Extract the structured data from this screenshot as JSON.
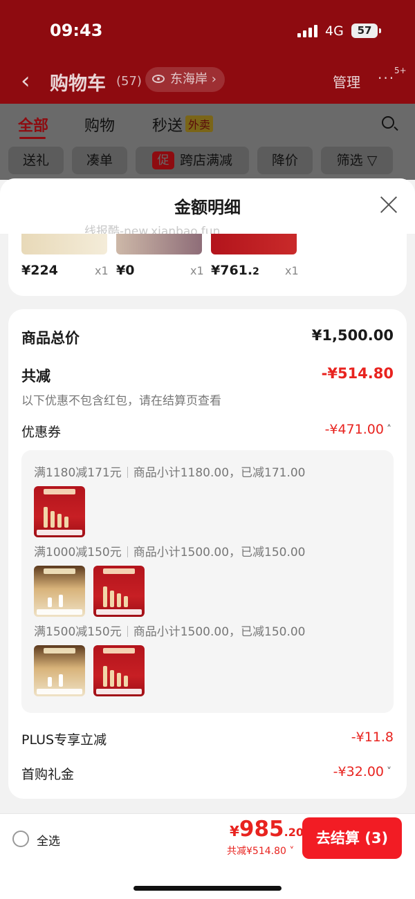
{
  "status": {
    "time": "09:43",
    "network": "4G",
    "battery": "57"
  },
  "header": {
    "title": "购物车",
    "count": "(57)",
    "location": "东海岸",
    "manage": "管理",
    "more": "···",
    "badge": "5+"
  },
  "tabs": [
    {
      "label": "全部",
      "active": true
    },
    {
      "label": "购物",
      "active": false
    },
    {
      "label": "秒送",
      "active": false,
      "tag": "外卖"
    }
  ],
  "filters": {
    "gift": "送礼",
    "bundle": "凑单",
    "promo_icon": "促",
    "cross_store": "跨店满减",
    "price_drop": "降价",
    "filter": "筛选"
  },
  "sheet": {
    "title": "金额明细",
    "watermark": "线报酷-new.xianbao.fun",
    "products": [
      {
        "price": "¥224",
        "qty": "x1"
      },
      {
        "price": "¥0",
        "qty": "x1"
      },
      {
        "price_main": "¥761.",
        "price_dec": "2",
        "qty": "x1"
      }
    ],
    "total_label": "商品总价",
    "total_value": "¥1,500.00",
    "reduce_label": "共减",
    "reduce_value": "-¥514.80",
    "reduce_note": "以下优惠不包含红包，请在结算页查看",
    "coupon_label": "优惠券",
    "coupon_value": "-¥471.00",
    "coupons": [
      {
        "rule": "满1180减171元",
        "detail": "商品小计1180.00，已减171.00"
      },
      {
        "rule": "满1000减150元",
        "detail": "商品小计1500.00，已减150.00"
      },
      {
        "rule": "满1500减150元",
        "detail": "商品小计1500.00，已减150.00"
      }
    ],
    "plus_label": "PLUS专享立减",
    "plus_value": "-¥11.8",
    "first_label": "首购礼金",
    "first_value": "-¥32.00"
  },
  "bottom": {
    "select_all": "全选",
    "pay_symbol": "¥",
    "pay_int": "985",
    "pay_dec": ".20",
    "reduce_text": "共减¥514.80",
    "checkout": "去结算 (3)"
  },
  "colors": {
    "accent_red": "#e8231f",
    "checkout_red": "#f21c24",
    "header_dim": "#8e0b10"
  }
}
